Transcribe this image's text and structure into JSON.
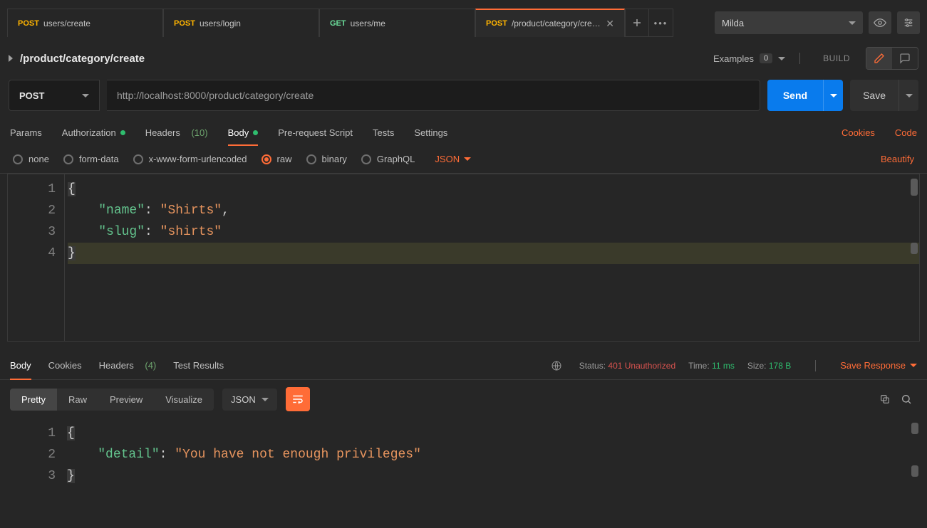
{
  "tabs": [
    {
      "method": "POST",
      "label": "users/create",
      "active": false,
      "closable": false
    },
    {
      "method": "POST",
      "label": "users/login",
      "active": false,
      "closable": false
    },
    {
      "method": "GET",
      "label": "users/me",
      "active": false,
      "closable": false
    },
    {
      "method": "POST",
      "label": "/product/category/create",
      "active": true,
      "closable": true
    }
  ],
  "env": {
    "name": "Milda"
  },
  "request": {
    "title": "/product/category/create",
    "examples_label": "Examples",
    "examples_count": "0",
    "build_label": "BUILD",
    "method": "POST",
    "url": "http://localhost:8000/product/category/create",
    "send_label": "Send",
    "save_label": "Save",
    "tabs": {
      "params": "Params",
      "authorization": "Authorization",
      "headers": "Headers",
      "headers_count": "(10)",
      "body": "Body",
      "prerequest": "Pre-request Script",
      "tests": "Tests",
      "settings": "Settings",
      "cookies": "Cookies",
      "code": "Code"
    },
    "body_types": {
      "none": "none",
      "formdata": "form-data",
      "urlencoded": "x-www-form-urlencoded",
      "raw": "raw",
      "binary": "binary",
      "graphql": "GraphQL",
      "lang": "JSON",
      "beautify": "Beautify"
    },
    "body_code": {
      "lines": [
        "1",
        "2",
        "3",
        "4"
      ],
      "l1_open": "{",
      "l2_key": "\"name\"",
      "l2_colon": ": ",
      "l2_val": "\"Shirts\"",
      "l2_comma": ",",
      "l3_key": "\"slug\"",
      "l3_colon": ": ",
      "l3_val": "\"shirts\"",
      "l4_close": "}"
    }
  },
  "response": {
    "tabs": {
      "body": "Body",
      "cookies": "Cookies",
      "headers": "Headers",
      "headers_count": "(4)",
      "testresults": "Test Results"
    },
    "meta": {
      "status_label": "Status:",
      "status_value": "401 Unauthorized",
      "time_label": "Time:",
      "time_value": "11 ms",
      "size_label": "Size:",
      "size_value": "178 B",
      "save_response": "Save Response"
    },
    "views": {
      "pretty": "Pretty",
      "raw": "Raw",
      "preview": "Preview",
      "visualize": "Visualize",
      "lang": "JSON"
    },
    "code": {
      "lines": [
        "1",
        "2",
        "3"
      ],
      "l1_open": "{",
      "l2_key": "\"detail\"",
      "l2_colon": ": ",
      "l2_val": "\"You have not enough privileges\"",
      "l3_close": "}"
    }
  }
}
